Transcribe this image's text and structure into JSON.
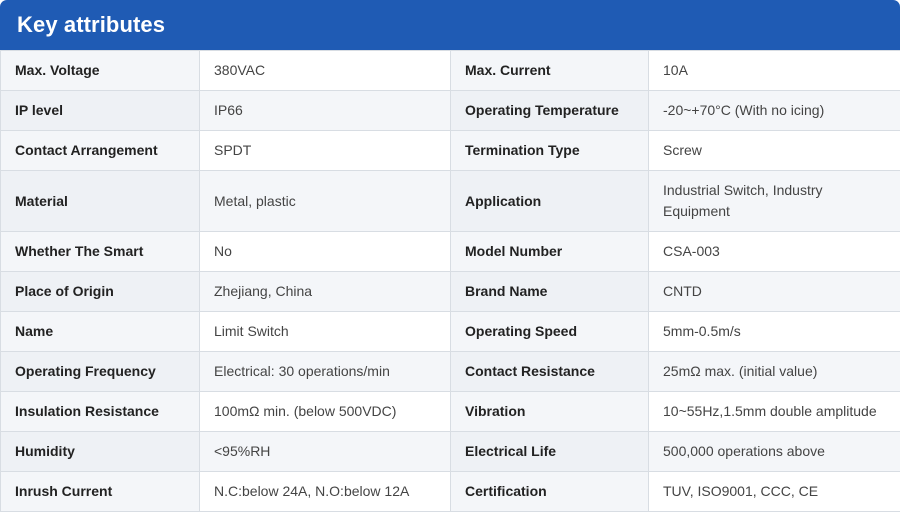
{
  "header": {
    "title": "Key attributes"
  },
  "rows": [
    {
      "k1": "Max. Voltage",
      "v1": "380VAC",
      "k2": "Max. Current",
      "v2": "10A"
    },
    {
      "k1": "IP level",
      "v1": "IP66",
      "k2": "Operating Temperature",
      "v2": "-20~+70°C (With no icing)"
    },
    {
      "k1": "Contact Arrangement",
      "v1": "SPDT",
      "k2": "Termination Type",
      "v2": "Screw"
    },
    {
      "k1": "Material",
      "v1": "Metal, plastic",
      "k2": "Application",
      "v2": "Industrial Switch, Industry Equipment"
    },
    {
      "k1": "Whether The Smart",
      "v1": "No",
      "k2": "Model Number",
      "v2": "CSA-003"
    },
    {
      "k1": "Place of Origin",
      "v1": "Zhejiang, China",
      "k2": "Brand Name",
      "v2": "CNTD"
    },
    {
      "k1": "Name",
      "v1": "Limit Switch",
      "k2": "Operating Speed",
      "v2": "5mm-0.5m/s"
    },
    {
      "k1": "Operating Frequency",
      "v1": "Electrical: 30 operations/min",
      "k2": "Contact Resistance",
      "v2": "25mΩ max. (initial value)"
    },
    {
      "k1": "Insulation Resistance",
      "v1": "100mΩ min. (below 500VDC)",
      "k2": "Vibration",
      "v2": "10~55Hz,1.5mm double amplitude"
    },
    {
      "k1": "Humidity",
      "v1": "<95%RH",
      "k2": "Electrical Life",
      "v2": "500,000 operations above"
    },
    {
      "k1": "Inrush Current",
      "v1": "N.C:below 24A, N.O:below 12A",
      "k2": "Certification",
      "v2": "TUV, ISO9001, CCC, CE"
    }
  ]
}
